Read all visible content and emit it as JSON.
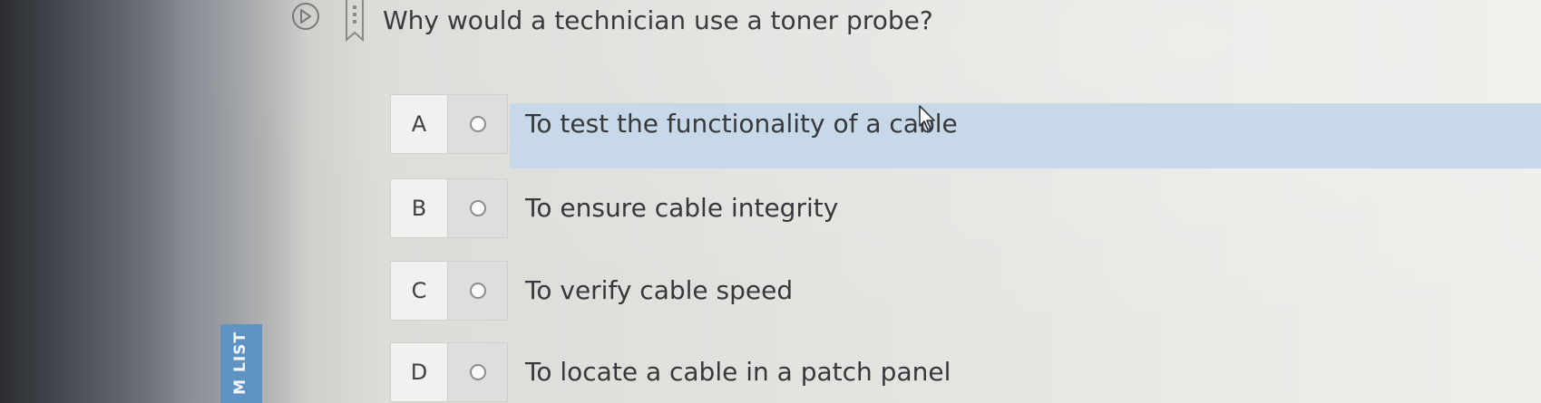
{
  "question": {
    "text": "Why would a technician use a toner probe?"
  },
  "options": [
    {
      "letter": "A",
      "text": "To test the functionality of a cable",
      "selected": true
    },
    {
      "letter": "B",
      "text": "To ensure cable integrity",
      "selected": false
    },
    {
      "letter": "C",
      "text": "To verify cable speed",
      "selected": false
    },
    {
      "letter": "D",
      "text": "To locate a cable in a patch panel",
      "selected": false
    }
  ],
  "side_tab": {
    "label": "M LIST"
  },
  "icons": {
    "play": "play-circle-icon",
    "bookmark": "bookmark-icon",
    "cursor": "mouse-pointer-icon"
  },
  "colors": {
    "highlight": "#c7d8e9",
    "side_tab": "#5e93c4"
  }
}
